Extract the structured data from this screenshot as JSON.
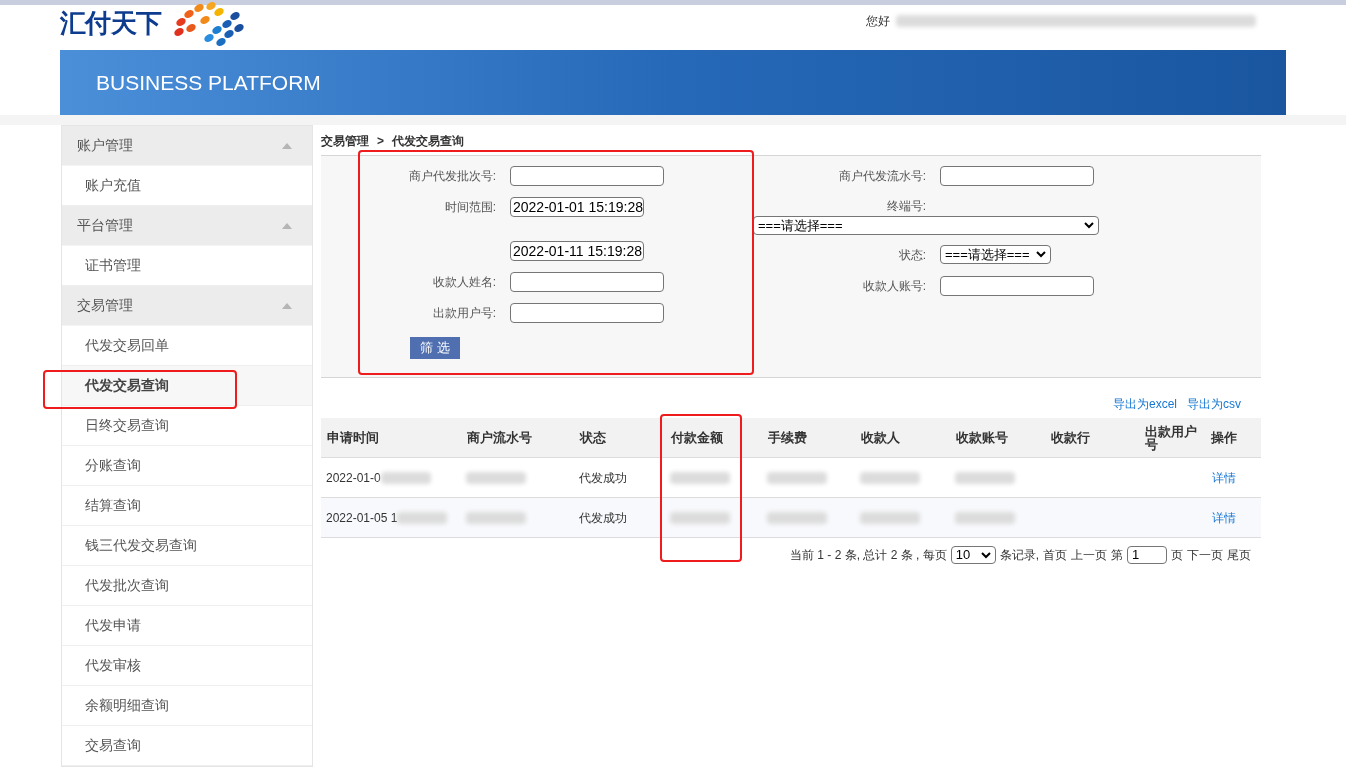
{
  "header": {
    "logo_text": "汇付天下",
    "greeting": "您好",
    "greeting_name_redacted": true,
    "banner_title": "BUSINESS PLATFORM"
  },
  "sidebar": {
    "groups": [
      {
        "title": "账户管理",
        "expanded": true,
        "items": [
          {
            "label": "账户充值",
            "selected": false
          }
        ]
      },
      {
        "title": "平台管理",
        "expanded": true,
        "items": [
          {
            "label": "证书管理",
            "selected": false
          }
        ]
      },
      {
        "title": "交易管理",
        "expanded": true,
        "items": [
          {
            "label": "代发交易回单",
            "selected": false
          },
          {
            "label": "代发交易查询",
            "selected": true
          },
          {
            "label": "日终交易查询",
            "selected": false
          },
          {
            "label": "分账查询",
            "selected": false
          },
          {
            "label": "结算查询",
            "selected": false
          },
          {
            "label": "钱三代发交易查询",
            "selected": false
          },
          {
            "label": "代发批次查询",
            "selected": false
          },
          {
            "label": "代发申请",
            "selected": false
          },
          {
            "label": "代发审核",
            "selected": false
          },
          {
            "label": "余额明细查询",
            "selected": false
          },
          {
            "label": "交易查询",
            "selected": false
          }
        ]
      }
    ]
  },
  "breadcrumb": [
    "交易管理",
    "代发交易查询"
  ],
  "breadcrumb_separator": ">",
  "filters": {
    "left": [
      {
        "kind": "text",
        "label": "商户代发批次号:"
      },
      {
        "kind": "date",
        "label": "时间范围:",
        "value": "2022-01-01 15:19:28"
      },
      {
        "kind": "date",
        "value": "2022-01-11 15:19:28"
      },
      {
        "kind": "text",
        "label": "收款人姓名:"
      },
      {
        "kind": "text",
        "label": "出款用户号:"
      }
    ],
    "right": [
      {
        "kind": "text",
        "label": "商户代发流水号:"
      },
      {
        "kind": "wide_select",
        "label": "终端号:",
        "value": "===请选择==="
      },
      {
        "kind": "select",
        "label": "状态:",
        "value": "===请选择==="
      },
      {
        "kind": "text",
        "label": "收款人账号:"
      }
    ],
    "submit": "筛 选"
  },
  "exports": [
    "导出为excel",
    "导出为csv"
  ],
  "table": {
    "columns": [
      "申请时间",
      "商户流水号",
      "状态",
      "付款金额",
      "手续费",
      "收款人",
      "收款账号",
      "收款行",
      "出款用户号",
      "操作"
    ],
    "rows": [
      {
        "cells": [
          {
            "text": "2022-01-0",
            "redacted": true
          },
          {
            "redacted": true
          },
          {
            "text": "代发成功",
            "redacted": false
          },
          {
            "redacted": true
          },
          {
            "redacted": true
          },
          {
            "redacted": true
          },
          {
            "redacted": true
          },
          {
            "redacted": false
          },
          {
            "redacted": false
          },
          {
            "text": "详情",
            "kind": "link",
            "redacted": false
          }
        ]
      },
      {
        "cells": [
          {
            "text": "2022-01-05 1",
            "redacted": true
          },
          {
            "redacted": true
          },
          {
            "text": "代发成功",
            "redacted": false
          },
          {
            "redacted": true
          },
          {
            "redacted": true
          },
          {
            "redacted": true
          },
          {
            "redacted": true
          },
          {
            "redacted": false
          },
          {
            "redacted": false
          },
          {
            "text": "详情",
            "kind": "link",
            "redacted": false
          }
        ]
      }
    ]
  },
  "pagination": {
    "summary": "当前 1 - 2 条, 总计 2 条 , 每页",
    "page_size": "10",
    "records_label": "条记录,",
    "first": "首页",
    "prev": "上一页",
    "page_prefix": "第",
    "page": "1",
    "page_suffix": "页",
    "next": "下一页",
    "last": "尾页"
  }
}
